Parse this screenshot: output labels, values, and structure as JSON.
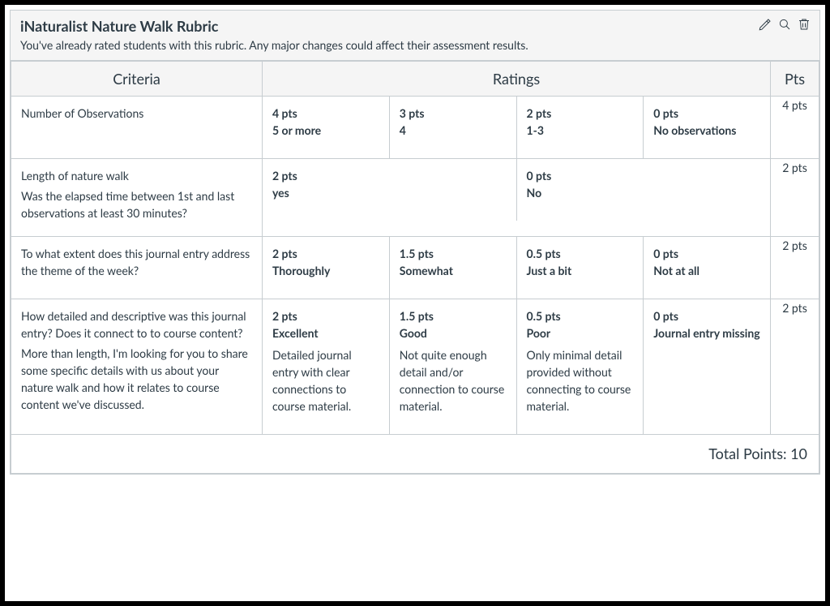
{
  "title": "iNaturalist Nature Walk Rubric",
  "subtitle": "You've already rated students with this rubric. Any major changes could affect their assessment results.",
  "icons": {
    "edit": "pencil-icon",
    "search": "magnifier-icon",
    "delete": "trash-icon"
  },
  "headers": {
    "criteria": "Criteria",
    "ratings": "Ratings",
    "pts": "Pts"
  },
  "criteria": [
    {
      "title": "Number of Observations",
      "details": [],
      "ratings": [
        {
          "pts": "4 pts",
          "label": "5 or more",
          "desc": ""
        },
        {
          "pts": "3 pts",
          "label": "4",
          "desc": ""
        },
        {
          "pts": "2 pts",
          "label": "1-3",
          "desc": ""
        },
        {
          "pts": "0 pts",
          "label": "No observations",
          "desc": ""
        }
      ],
      "pts": "4 pts"
    },
    {
      "title": "Length of nature walk",
      "details": [
        "Was the elapsed time between 1st and last observations at least 30 minutes?"
      ],
      "ratings": [
        {
          "pts": "2 pts",
          "label": "yes",
          "desc": ""
        },
        {
          "pts": "0 pts",
          "label": "No",
          "desc": ""
        }
      ],
      "pts": "2 pts"
    },
    {
      "title": "To what extent does this journal entry address the theme of the week?",
      "details": [],
      "ratings": [
        {
          "pts": "2 pts",
          "label": "Thoroughly",
          "desc": ""
        },
        {
          "pts": "1.5 pts",
          "label": "Somewhat",
          "desc": ""
        },
        {
          "pts": "0.5 pts",
          "label": "Just a bit",
          "desc": ""
        },
        {
          "pts": "0 pts",
          "label": "Not at all",
          "desc": ""
        }
      ],
      "pts": "2 pts"
    },
    {
      "title": "How detailed and descriptive was this journal entry? Does it connect to to course content?",
      "details": [
        "More than length, I'm looking for you to share some specific details with us about your nature walk and how it relates to course content we've discussed."
      ],
      "ratings": [
        {
          "pts": "2 pts",
          "label": "Excellent",
          "desc": "Detailed journal entry with clear connections to course material."
        },
        {
          "pts": "1.5 pts",
          "label": "Good",
          "desc": "Not quite enough detail and/or connection to course material."
        },
        {
          "pts": "0.5 pts",
          "label": "Poor",
          "desc": "Only minimal detail provided without connecting to course material."
        },
        {
          "pts": "0 pts",
          "label": "Journal entry missing",
          "desc": ""
        }
      ],
      "pts": "2 pts"
    }
  ],
  "total": "Total Points: 10"
}
